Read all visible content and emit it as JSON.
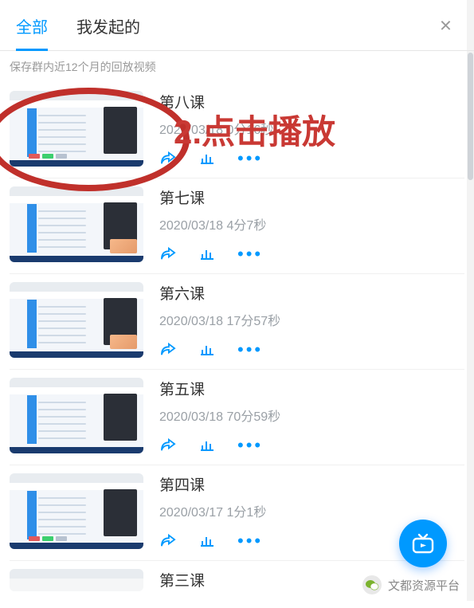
{
  "tabs": {
    "all": "全部",
    "mine": "我发起的",
    "active_index": 0
  },
  "close_glyph": "×",
  "hint": "保存群内近12个月的回放视频",
  "annotation": {
    "text": "2.点击播放"
  },
  "videos": [
    {
      "title": "第八课",
      "sub": "2020/03/18 0分16秒"
    },
    {
      "title": "第七课",
      "sub": "2020/03/18 4分7秒"
    },
    {
      "title": "第六课",
      "sub": "2020/03/18 17分57秒"
    },
    {
      "title": "第五课",
      "sub": "2020/03/18 70分59秒"
    },
    {
      "title": "第四课",
      "sub": "2020/03/17 1分1秒"
    },
    {
      "title": "第三课",
      "sub": ""
    }
  ],
  "dots_glyph": "•••",
  "account_name": "文都资源平台",
  "colors": {
    "accent": "#0099ff",
    "annotation": "#c0302b"
  }
}
